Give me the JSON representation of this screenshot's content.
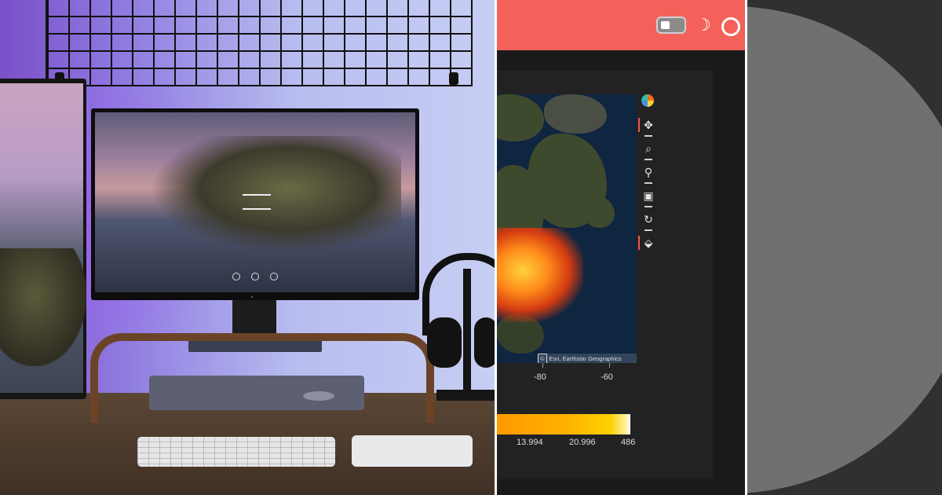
{
  "app": {
    "toolbar": {
      "logo_icon": "bokeh-logo-icon",
      "tools": [
        "pan-icon",
        "box-zoom-icon",
        "wheel-zoom-icon",
        "save-icon",
        "reset-icon",
        "hover-icon"
      ]
    },
    "map": {
      "attribution": "Esri, Earthstar Geographics",
      "x_ticks": [
        "-80",
        "-60"
      ]
    },
    "colorbar": {
      "labels": [
        "13.994",
        "20.996",
        "486"
      ]
    },
    "header": {
      "toggle_icon": "theme-toggle-icon",
      "moon_icon": "dark-mode-moon-icon",
      "circle_icon": "circle-button-icon"
    }
  },
  "colors": {
    "header": "#f3615a",
    "app_background": "#1a1a1a",
    "plot_background": "#222222",
    "accent": "#ec5a56",
    "disk_panel": "#303030",
    "disk": "#707070"
  }
}
